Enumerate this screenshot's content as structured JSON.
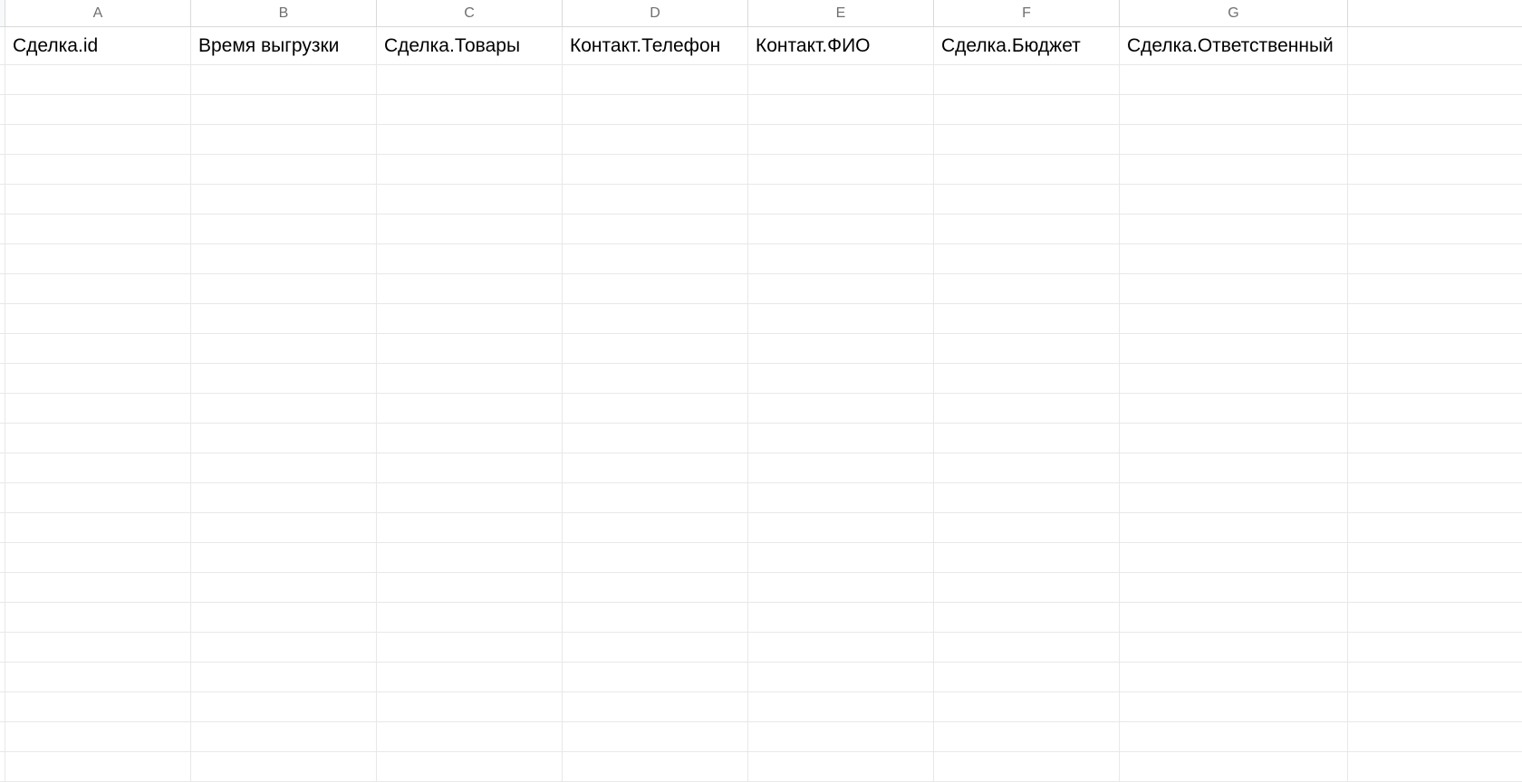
{
  "columns": {
    "letters": [
      "A",
      "B",
      "C",
      "D",
      "E",
      "F",
      "G"
    ]
  },
  "header_row": {
    "cells": [
      "Сделка.id",
      "Время выгрузки",
      "Сделка.Товары",
      "Контакт.Телефон",
      "Контакт.ФИО",
      "Сделка.Бюджет",
      "Сделка.Ответственный"
    ]
  },
  "empty_rows": 24
}
